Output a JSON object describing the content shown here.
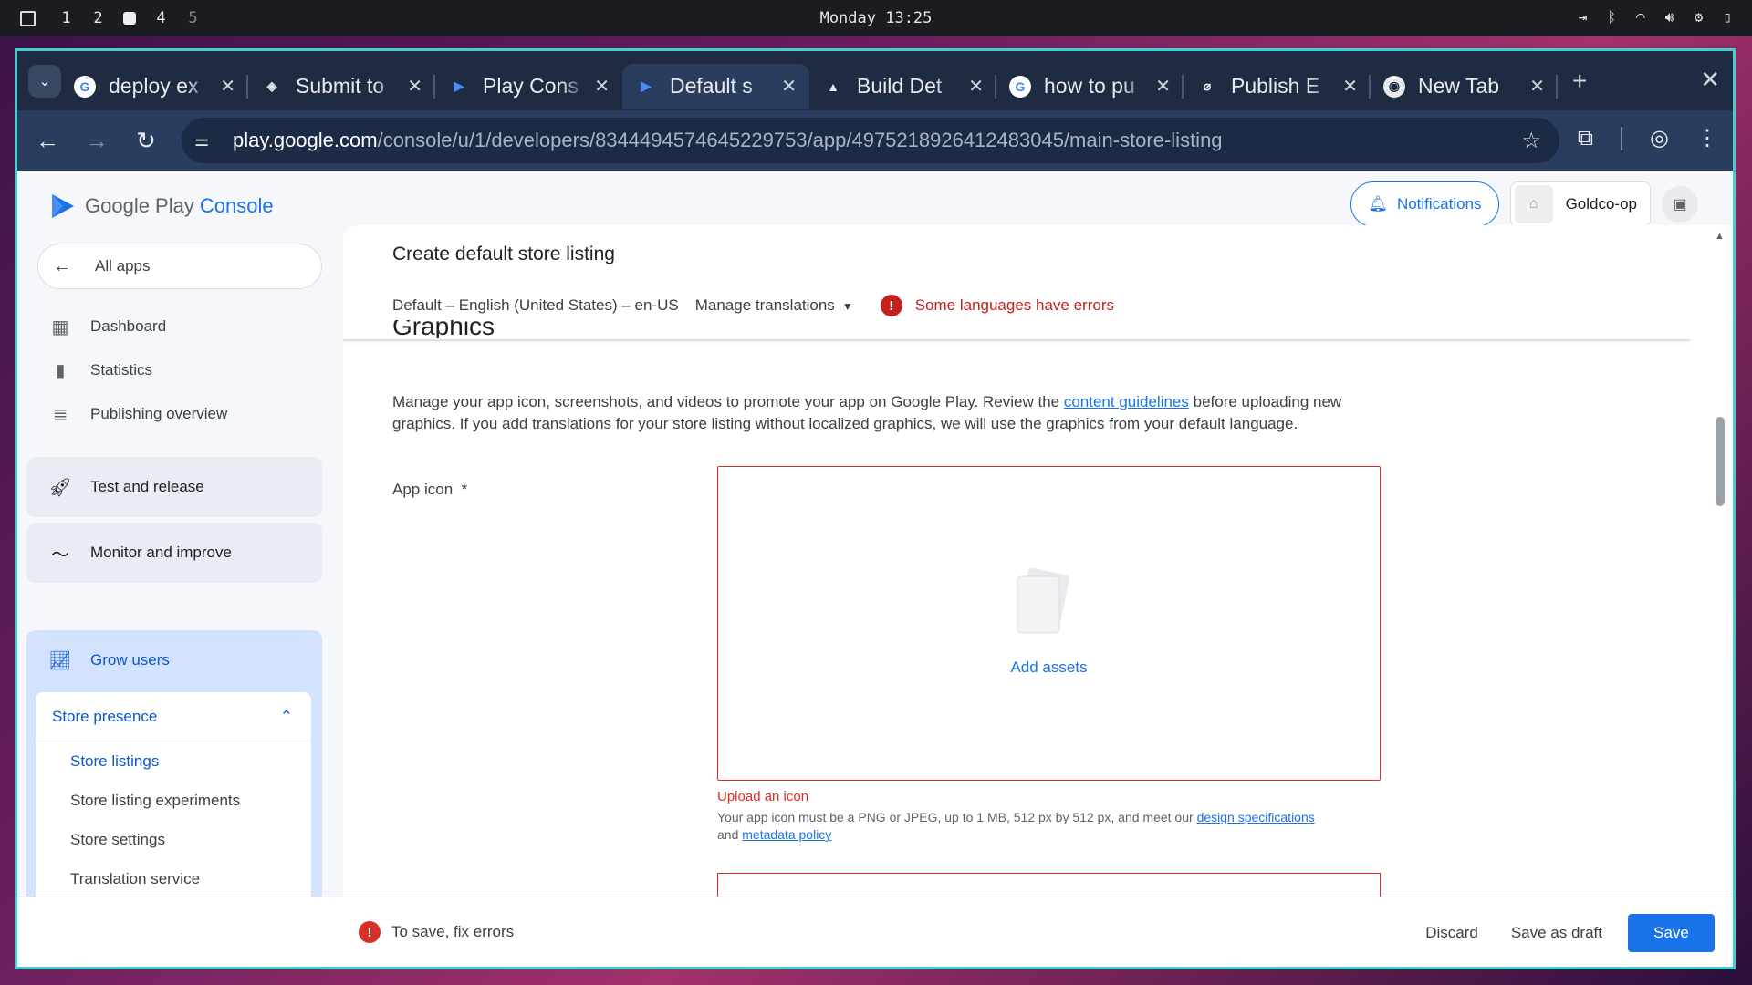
{
  "system": {
    "workspaces": [
      "1",
      "2",
      "4",
      "5"
    ],
    "clock": "Monday 13:25"
  },
  "browser": {
    "tabs": [
      {
        "label": "deploy ex",
        "icon": "google-icon",
        "color": "#4285f4"
      },
      {
        "label": "Submit to",
        "icon": "expo-icon",
        "color": "#ffffff"
      },
      {
        "label": "Play Cons",
        "icon": "play-console-icon",
        "color": "#4285f4"
      },
      {
        "label": "Default s",
        "icon": "play-console-icon",
        "color": "#4285f4",
        "active": true
      },
      {
        "label": "Build Det",
        "icon": "expo-build-icon",
        "color": "#ffffff"
      },
      {
        "label": "how to pu",
        "icon": "google-icon",
        "color": "#4285f4"
      },
      {
        "label": "Publish E",
        "icon": "publish-icon",
        "color": "#ffffff"
      },
      {
        "label": "New Tab",
        "icon": "chrome-icon",
        "color": "#ffffff"
      }
    ],
    "url_host": "play.google.com",
    "url_path": "/console/u/1/developers/8344494574645229753/app/4975218926412483045/main-store-listing"
  },
  "header": {
    "brand_google_play": "Google Play",
    "brand_console": "Console",
    "notifications_label": "Notifications",
    "account_name": "Goldco-op"
  },
  "sidebar": {
    "all_apps": "All apps",
    "items": [
      {
        "label": "Dashboard",
        "icon": "dashboard-icon"
      },
      {
        "label": "Statistics",
        "icon": "bar-chart-icon"
      },
      {
        "label": "Publishing overview",
        "icon": "publishing-icon"
      }
    ],
    "sections": [
      {
        "label": "Test and release",
        "icon": "rocket-icon"
      },
      {
        "label": "Monitor and improve",
        "icon": "pulse-icon"
      }
    ],
    "grow_users": "Grow users",
    "store_presence": "Store presence",
    "store_sub": [
      "Store listings",
      "Store listing experiments",
      "Store settings",
      "Translation service"
    ]
  },
  "main": {
    "title": "Create default store listing",
    "language": "Default – English (United States) – en-US",
    "manage_translations": "Manage translations",
    "errors_notice": "Some languages have errors",
    "section_heading": "Graphics",
    "description_pre": "Manage your app icon, screenshots, and videos to promote your app on Google Play. Review the ",
    "description_link": "content guidelines",
    "description_post": " before uploading new graphics. If you add translations for your store listing without localized graphics, we will use the graphics from your default language.",
    "app_icon_label": "App icon",
    "required_mark": "*",
    "add_assets": "Add assets",
    "upload_error": "Upload an icon",
    "help_pre": "Your app icon must be a PNG or JPEG, up to 1 MB, 512 px by 512 px, and meet our ",
    "help_link1": "design specifications",
    "help_mid": "and ",
    "help_link2": "metadata policy"
  },
  "footer": {
    "fix_errors": "To save, fix errors",
    "discard": "Discard",
    "save_draft": "Save as draft",
    "save": "Save"
  }
}
